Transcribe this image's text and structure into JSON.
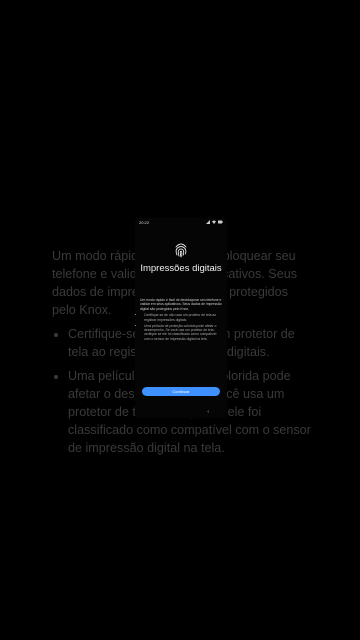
{
  "background": {
    "paragraph": "Um modo rápido e fácil de desbloquear seu telefone e validar em seus aplicativos. Seus dados de impressão digital são protegidos pelo Knox.",
    "bullets": [
      "Certifique-se de não usar um protetor de tela ao registrar impressões digitais.",
      "Uma película de proteção colorida pode afetar o desempenho. Se você usa um protetor de tela, verifique se ele foi classificado como compatível com o sensor de impressão digital na tela."
    ]
  },
  "status_bar": {
    "time": "20:22",
    "icons": [
      "signal-icon",
      "wifi-icon",
      "battery-icon"
    ]
  },
  "screen": {
    "icon": "fingerprint-icon",
    "title": "Impressões digitais",
    "description": "Um modo rápido e fácil de desbloquear seu telefone e validar em seus aplicativos. Seus dados de impressão digital são protegidos pelo Knox.",
    "bullets": [
      "Certifique-se de não usar um protetor de tela ao registrar impressões digitais.",
      "Uma película de proteção colorida pode afetar o desempenho. Se você usa um protetor de tela, verifique se ele foi classificado como compatível com o sensor de impressão digital na tela."
    ],
    "continue_label": "Continuar",
    "accent_color": "#3e91ff"
  },
  "nav": {
    "back_icon": "chevron-left-icon",
    "back_glyph": "‹"
  }
}
